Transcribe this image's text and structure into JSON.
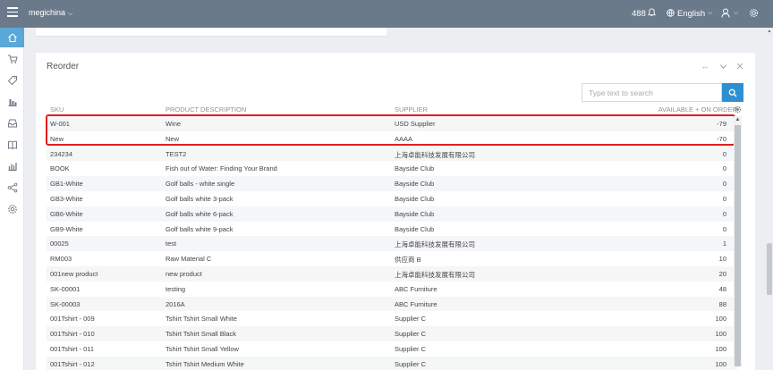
{
  "topbar": {
    "company": "megichina",
    "notifications_count": "488",
    "language": "English"
  },
  "sidebar": {
    "items": [
      {
        "icon": "home-icon",
        "active": true
      },
      {
        "icon": "cart-icon"
      },
      {
        "icon": "tag-icon"
      },
      {
        "icon": "bar-chart-icon"
      },
      {
        "icon": "inbox-icon"
      },
      {
        "icon": "book-icon"
      },
      {
        "icon": "report-icon"
      },
      {
        "icon": "share-icon"
      },
      {
        "icon": "gear-icon"
      }
    ]
  },
  "panel": {
    "title": "Reorder",
    "search_placeholder": "Type text to search",
    "columns": {
      "sku": "SKU",
      "description": "PRODUCT DESCRIPTION",
      "supplier": "SUPPLIER",
      "qty": "AVAILABLE + ON ORDER"
    },
    "rows": [
      {
        "sku": "W-001",
        "description": "Wine",
        "supplier": "USD Supplier",
        "qty": "-79"
      },
      {
        "sku": "New",
        "description": "New",
        "supplier": "AAAA",
        "qty": "-70"
      },
      {
        "sku": "234234",
        "description": "TEST2",
        "supplier": "上海卓能科技发展有限公司",
        "qty": "0"
      },
      {
        "sku": "BOOK",
        "description": "Fish out of Water: Finding Your Brand",
        "supplier": "Bayside Club",
        "qty": "0"
      },
      {
        "sku": "GB1-White",
        "description": "Golf balls - white single",
        "supplier": "Bayside Club",
        "qty": "0"
      },
      {
        "sku": "GB3-White",
        "description": "Golf balls white 3-pack",
        "supplier": "Bayside Club",
        "qty": "0"
      },
      {
        "sku": "GB6-White",
        "description": "Golf balls white 6-pack",
        "supplier": "Bayside Club",
        "qty": "0"
      },
      {
        "sku": "GB9-White",
        "description": "Golf balls white 9-pack",
        "supplier": "Bayside Club",
        "qty": "0"
      },
      {
        "sku": "00025",
        "description": "test",
        "supplier": "上海卓能科技发展有限公司",
        "qty": "1"
      },
      {
        "sku": "RM003",
        "description": "Raw Material C",
        "supplier": "供应商 B",
        "qty": "10"
      },
      {
        "sku": "001new product",
        "description": "new product",
        "supplier": "上海卓能科技发展有限公司",
        "qty": "20"
      },
      {
        "sku": "SK-00001",
        "description": "testing",
        "supplier": "ABC Furniture",
        "qty": "48"
      },
      {
        "sku": "SK-00003",
        "description": "2016A",
        "supplier": "ABC Furniture",
        "qty": "88"
      },
      {
        "sku": "001Tshirt - 009",
        "description": "Tshirt Tshirt Small White",
        "supplier": "Supplier C",
        "qty": "100"
      },
      {
        "sku": "001Tshirt - 010",
        "description": "Tshirt Tshirt Small Black",
        "supplier": "Supplier C",
        "qty": "100"
      },
      {
        "sku": "001Tshirt - 011",
        "description": "Tshirt Tshirt Small Yellow",
        "supplier": "Supplier C",
        "qty": "100"
      },
      {
        "sku": "001Tshirt - 012",
        "description": "Tshirt Tshirt Medium White",
        "supplier": "Supplier C",
        "qty": "100"
      }
    ]
  },
  "colors": {
    "topbar": "#6b7a8b",
    "accent": "#2f8fd3",
    "highlight_border": "#e0201d"
  }
}
